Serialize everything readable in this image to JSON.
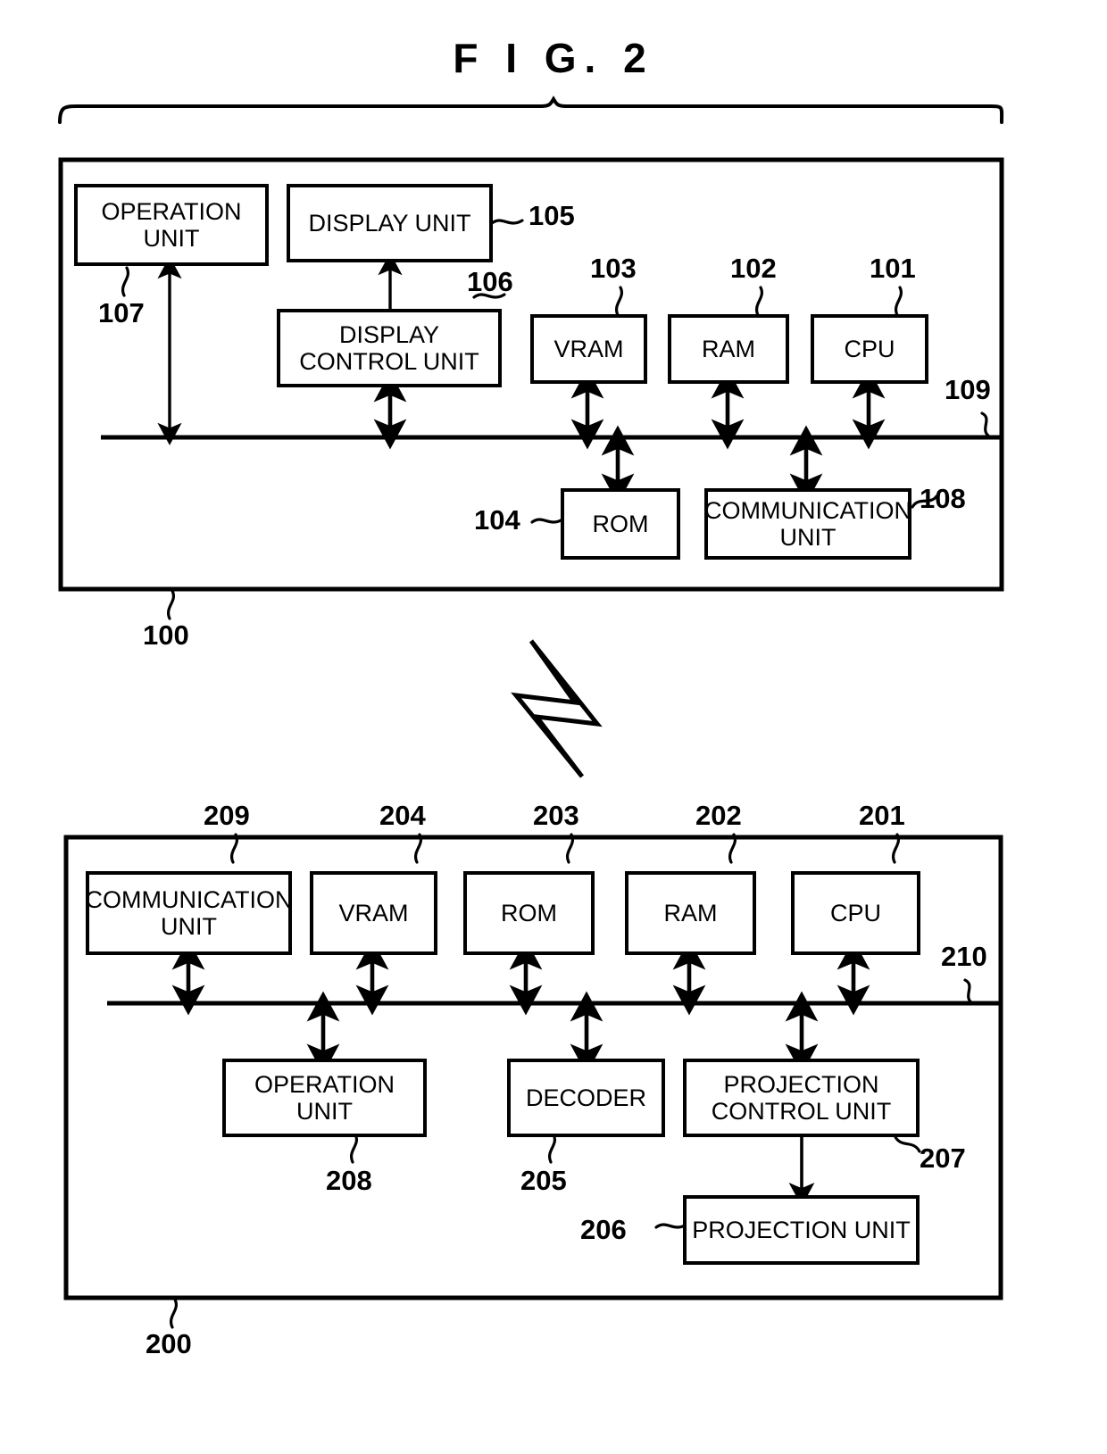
{
  "figure": {
    "title": "F I G.  2"
  },
  "top_system": {
    "ref": "100",
    "bus_ref": "109",
    "blocks": [
      {
        "id": "operation-unit",
        "label": "OPERATION\nUNIT",
        "ref": "107"
      },
      {
        "id": "display-unit",
        "label": "DISPLAY UNIT",
        "ref": "105"
      },
      {
        "id": "display-control-unit",
        "label": "DISPLAY\nCONTROL UNIT",
        "ref": "106"
      },
      {
        "id": "vram",
        "label": "VRAM",
        "ref": "103"
      },
      {
        "id": "ram",
        "label": "RAM",
        "ref": "102"
      },
      {
        "id": "cpu",
        "label": "CPU",
        "ref": "101"
      },
      {
        "id": "rom",
        "label": "ROM",
        "ref": "104"
      },
      {
        "id": "communication-unit",
        "label": "COMMUNICATION\nUNIT",
        "ref": "108"
      }
    ]
  },
  "bottom_system": {
    "ref": "200",
    "bus_ref": "210",
    "blocks": [
      {
        "id": "communication-unit",
        "label": "COMMUNICATION\nUNIT",
        "ref": "209"
      },
      {
        "id": "vram",
        "label": "VRAM",
        "ref": "204"
      },
      {
        "id": "rom",
        "label": "ROM",
        "ref": "203"
      },
      {
        "id": "ram",
        "label": "RAM",
        "ref": "202"
      },
      {
        "id": "cpu",
        "label": "CPU",
        "ref": "201"
      },
      {
        "id": "operation-unit",
        "label": "OPERATION\nUNIT",
        "ref": "208"
      },
      {
        "id": "decoder",
        "label": "DECODER",
        "ref": "205"
      },
      {
        "id": "projection-control-unit",
        "label": "PROJECTION\nCONTROL UNIT",
        "ref": "207"
      },
      {
        "id": "projection-unit",
        "label": "PROJECTION UNIT",
        "ref": "206"
      }
    ]
  },
  "link": {
    "icon": "wireless-lightning-bolt"
  },
  "colors": {
    "ink": "#000000",
    "paper": "#ffffff"
  }
}
